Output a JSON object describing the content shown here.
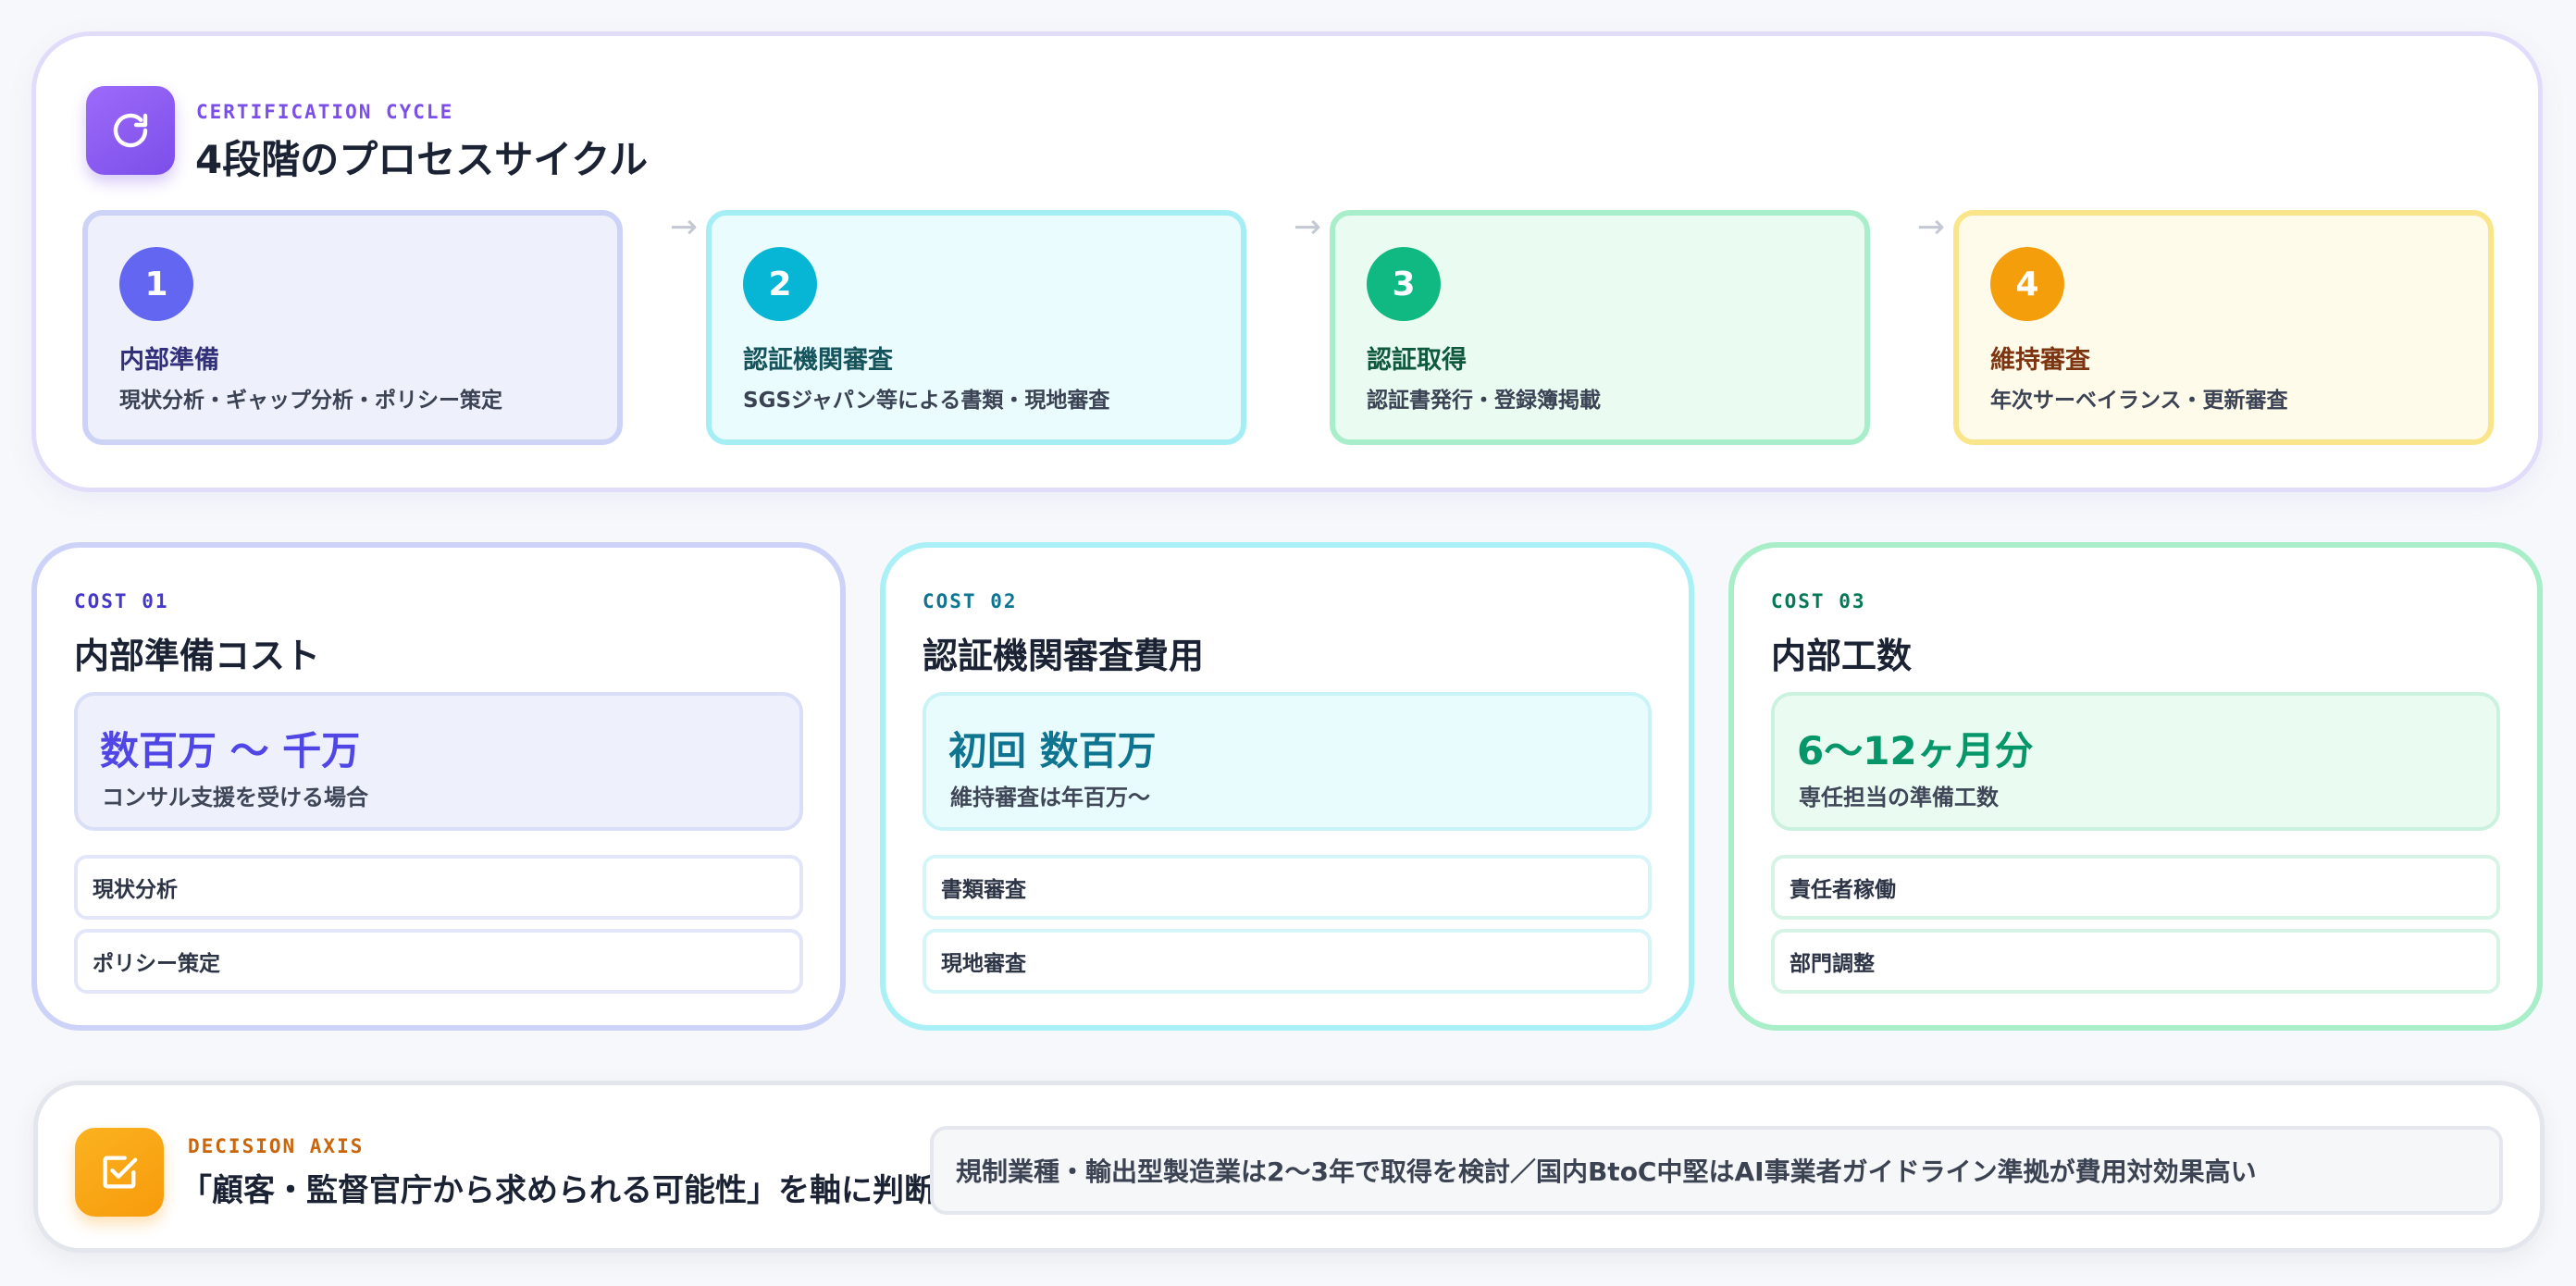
{
  "cycle": {
    "eyebrow": "CERTIFICATION CYCLE",
    "title": "4段階のプロセスサイクル",
    "icon": "refresh-icon",
    "steps": [
      {
        "num": "1",
        "title": "内部準備",
        "desc": "現状分析・ギャップ分析・ポリシー策定",
        "color": "#6366f1"
      },
      {
        "num": "2",
        "title": "認証機関審査",
        "desc": "SGSジャパン等による書類・現地審査",
        "color": "#06b6d4"
      },
      {
        "num": "3",
        "title": "認証取得",
        "desc": "認証書発行・登録簿掲載",
        "color": "#10b981"
      },
      {
        "num": "4",
        "title": "維持審査",
        "desc": "年次サーベイランス・更新審査",
        "color": "#f59e0b"
      }
    ],
    "arrow": "→"
  },
  "costs": [
    {
      "eyebrow": "COST 01",
      "title": "内部準備コスト",
      "value": "数百万 〜 千万",
      "sub": "コンサル支援を受ける場合",
      "items": [
        "現状分析",
        "ポリシー策定"
      ],
      "color": "#4f46e5"
    },
    {
      "eyebrow": "COST 02",
      "title": "認証機関審査費用",
      "value": "初回 数百万",
      "sub": "維持審査は年百万〜",
      "items": [
        "書類審査",
        "現地審査"
      ],
      "color": "#0e7490"
    },
    {
      "eyebrow": "COST 03",
      "title": "内部工数",
      "value": "6〜12ヶ月分",
      "sub": "専任担当の準備工数",
      "items": [
        "責任者稼働",
        "部門調整"
      ],
      "color": "#059669"
    }
  ],
  "decision": {
    "eyebrow": "DECISION AXIS",
    "title": "「顧客・監督官庁から求められる可能性」を軸に判断",
    "note": "規制業種・輸出型製造業は2〜3年で取得を検討／国内BtoC中堅はAI事業者ガイドライン準拠が費用対効果高い",
    "icon": "checkbox-icon",
    "color": "#f59e0b"
  }
}
